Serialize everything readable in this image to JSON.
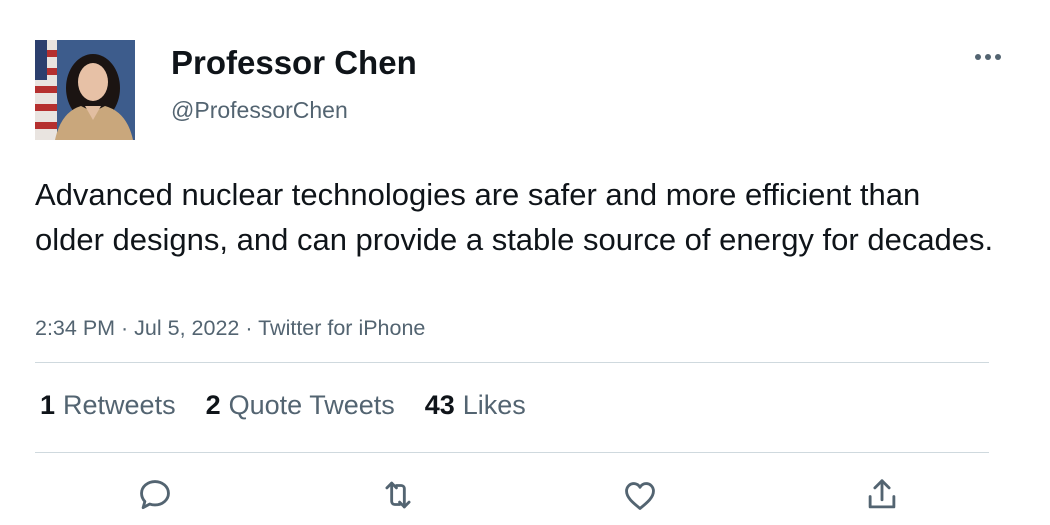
{
  "tweet": {
    "author": {
      "display_name": "Professor Chen",
      "handle": "@ProfessorChen",
      "avatar": "profile-photo"
    },
    "text": "Advanced nuclear technologies are safer and more efficient than older designs, and can provide a stable source of energy for decades.",
    "timestamp": "2:34 PM · Jul 5, 2022 · ",
    "source": "Twitter for iPhone",
    "stats": {
      "retweets_count": "1",
      "retweets_label": "Retweets",
      "quotes_count": "2",
      "quotes_label": "Quote Tweets",
      "likes_count": "43",
      "likes_label": "Likes"
    }
  },
  "icons": {
    "more": "more-horizontal-icon",
    "reply": "reply-icon",
    "retweet": "retweet-icon",
    "like": "heart-icon",
    "share": "share-icon"
  },
  "colors": {
    "text_primary": "#0f1419",
    "text_secondary": "#536471",
    "divider": "#cfd9de"
  }
}
